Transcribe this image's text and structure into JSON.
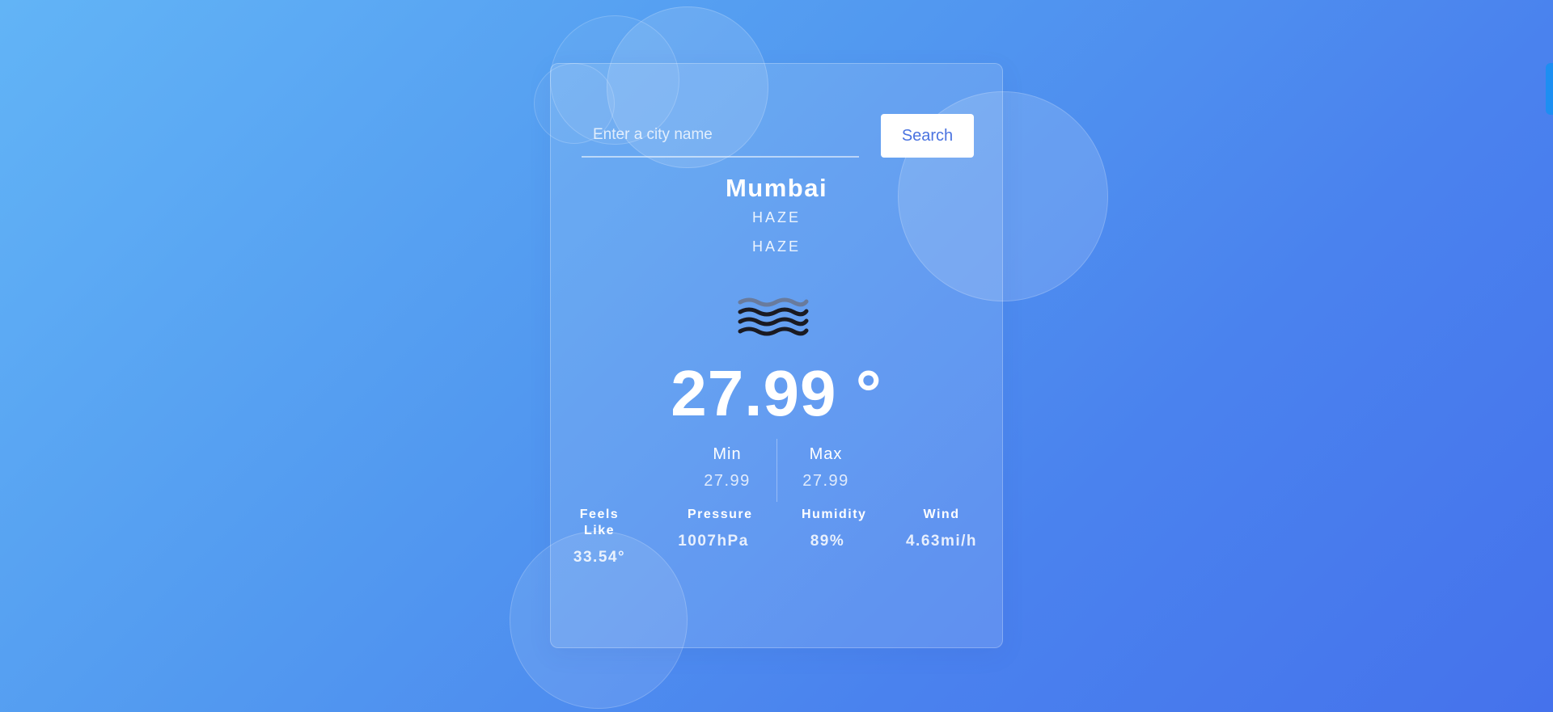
{
  "search": {
    "placeholder": "Enter a city name",
    "value": "",
    "button_label": "Search"
  },
  "weather": {
    "city": "Mumbai",
    "condition_main": "HAZE",
    "condition_description": "HAZE",
    "icon": "haze-icon",
    "temperature": "27.99 °",
    "min": {
      "label": "Min",
      "value": "27.99"
    },
    "max": {
      "label": "Max",
      "value": "27.99"
    },
    "details": [
      {
        "label": "Feels Like",
        "value": "33.54°"
      },
      {
        "label": "Pressure",
        "value": "1007hPa"
      },
      {
        "label": "Humidity",
        "value": "89%"
      },
      {
        "label": "Wind",
        "value": "4.63mi/h"
      }
    ]
  },
  "colors": {
    "background_start": "#62b4f6",
    "background_end": "#4572ec",
    "button_text": "#4a73e0",
    "edge_tab": "#1d8ef2"
  }
}
